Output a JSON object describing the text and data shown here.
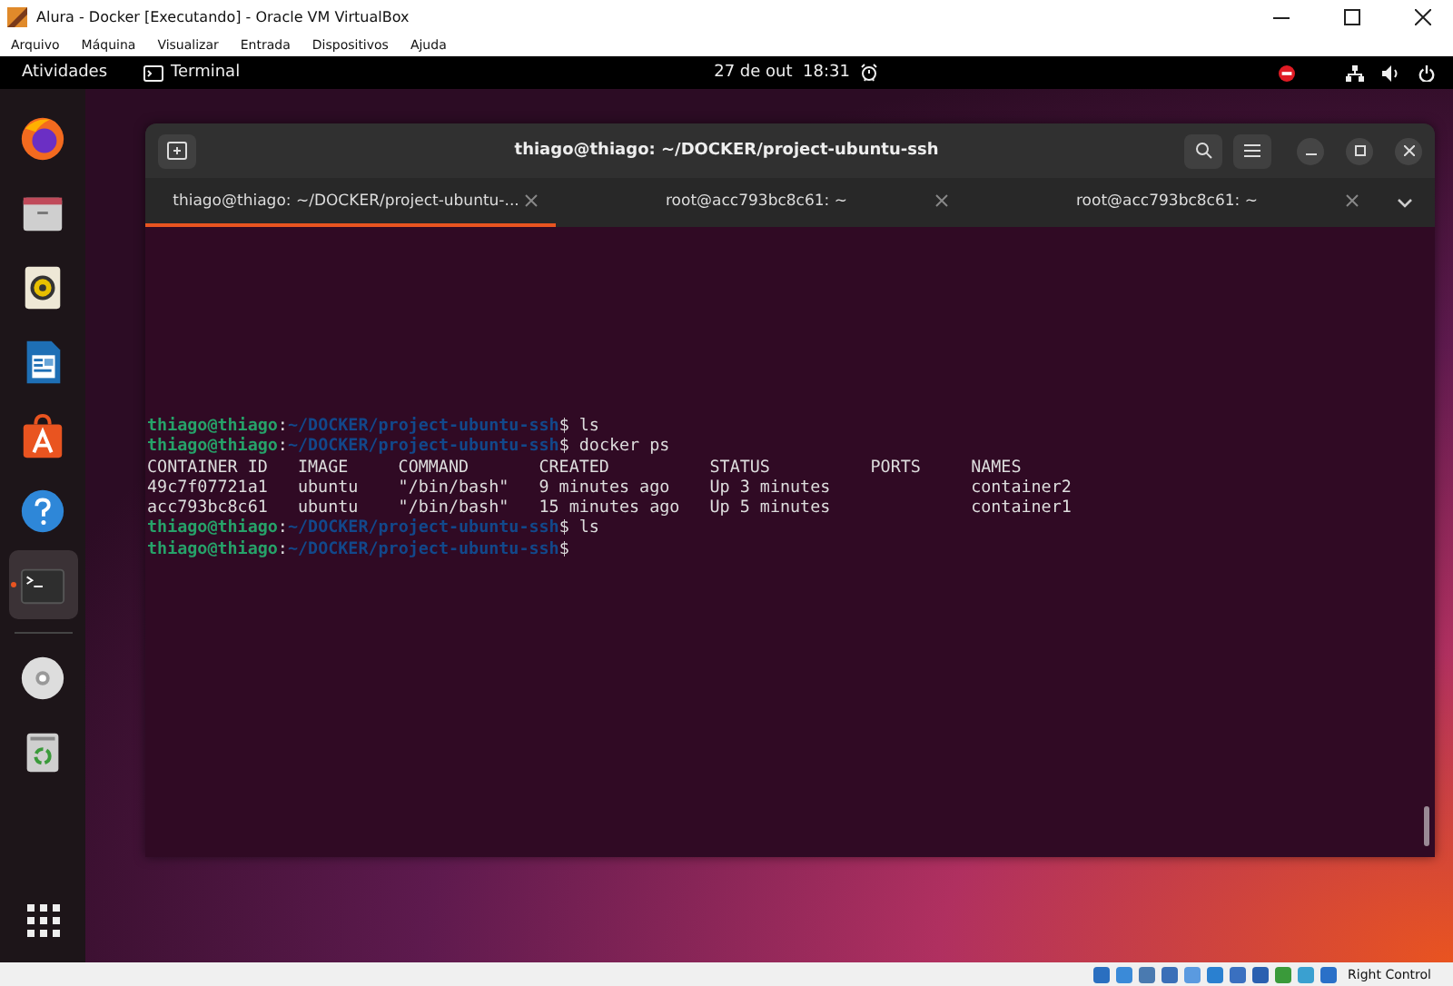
{
  "vbox": {
    "title": "Alura - Docker [Executando] - Oracle VM VirtualBox",
    "menu": [
      "Arquivo",
      "Máquina",
      "Visualizar",
      "Entrada",
      "Dispositivos",
      "Ajuda"
    ],
    "host_key": "Right Control"
  },
  "topbar": {
    "activities": "Atividades",
    "app": "Terminal",
    "date": "27 de out",
    "time": "18:31"
  },
  "dock": [
    {
      "kind": "browser",
      "running": false
    },
    {
      "kind": "files",
      "running": false
    },
    {
      "kind": "music",
      "running": false
    },
    {
      "kind": "writer",
      "running": false
    },
    {
      "kind": "software",
      "running": false
    },
    {
      "kind": "help",
      "running": false
    },
    {
      "kind": "terminal",
      "running": true
    },
    {
      "kind": "disc",
      "running": false
    },
    {
      "kind": "trash",
      "running": false
    }
  ],
  "terminal": {
    "title": "thiago@thiago: ~/DOCKER/project-ubuntu-ssh",
    "tabs": [
      {
        "label": "thiago@thiago: ~/DOCKER/project-ubuntu-...",
        "selected": true
      },
      {
        "label": "root@acc793bc8c61: ~",
        "selected": false
      },
      {
        "label": "root@acc793bc8c61: ~",
        "selected": false
      }
    ],
    "lines": [
      {
        "kind": "prompt",
        "user": "thiago@thiago",
        "sep": ":",
        "path": "~/DOCKER/project-ubuntu-ssh",
        "rest": "$ ls"
      },
      {
        "kind": "prompt",
        "user": "thiago@thiago",
        "sep": ":",
        "path": "~/DOCKER/project-ubuntu-ssh",
        "rest": "$ docker ps"
      },
      {
        "kind": "output",
        "text": "CONTAINER ID   IMAGE     COMMAND       CREATED          STATUS          PORTS     NAMES"
      },
      {
        "kind": "output",
        "text": "49c7f07721a1   ubuntu    \"/bin/bash\"   9 minutes ago    Up 3 minutes              container2"
      },
      {
        "kind": "output",
        "text": "acc793bc8c61   ubuntu    \"/bin/bash\"   15 minutes ago   Up 5 minutes              container1"
      },
      {
        "kind": "prompt",
        "user": "thiago@thiago",
        "sep": ":",
        "path": "~/DOCKER/project-ubuntu-ssh",
        "rest": "$ ls"
      },
      {
        "kind": "prompt",
        "user": "thiago@thiago",
        "sep": ":",
        "path": "~/DOCKER/project-ubuntu-ssh",
        "rest": "$"
      }
    ]
  }
}
